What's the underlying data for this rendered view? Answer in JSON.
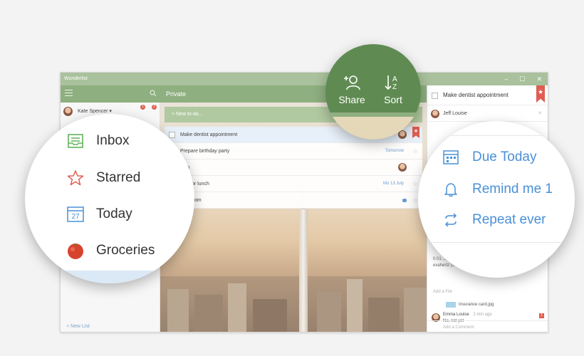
{
  "window": {
    "title": "Wunderlist",
    "min": "–",
    "max": "☐",
    "close": "✕"
  },
  "toolbar": {
    "list_title": "Private"
  },
  "user": {
    "name": "Kate Spencer ▾",
    "badge_a": "1",
    "badge_b": "2"
  },
  "sidebar": {
    "new_list": "+ New List"
  },
  "zoom_left": {
    "items": [
      {
        "label": "Inbox",
        "icon": "inbox-icon"
      },
      {
        "label": "Starred",
        "icon": "star-icon"
      },
      {
        "label": "Today",
        "icon": "calendar-icon",
        "day": "27"
      },
      {
        "label": "Groceries",
        "icon": "tomato-icon"
      }
    ]
  },
  "zoom_top": {
    "share": "Share",
    "sort": "Sort"
  },
  "new_todo": "+ New to-do...",
  "tasks": [
    {
      "title": "Make dentist appointment",
      "flag": "★"
    },
    {
      "title": "Prepare birthday party",
      "date": "Tomorrow",
      "star": "☆"
    },
    {
      "title": "Tom"
    },
    {
      "title": "Erik for lunch",
      "date": "Mo 13 July",
      "star": "☆"
    },
    {
      "title": "bathroom",
      "star": "☆"
    }
  ],
  "detail": {
    "title": "Make dentist appointment",
    "flag": "★",
    "assignee": "Jeff Louise",
    "remove": "✕",
    "note": "0.01 ... frequencies in the range 30 petahertz to 30 exahertz (3×1016 Hz to 3×1019 Hz)",
    "add_file": "Add a File",
    "file_name": "Insurance card.jpg",
    "comment_author": "Emma Louise",
    "comment_time": "2 min ago",
    "comment_text": "No, not yet",
    "comment_count": "1",
    "add_comment": "Add a Comment"
  },
  "zoom_right": {
    "items": [
      {
        "label": "Due Today",
        "icon": "due-date-icon"
      },
      {
        "label": "Remind me 1",
        "icon": "bell-icon"
      },
      {
        "label": "Repeat ever",
        "icon": "repeat-icon"
      }
    ]
  },
  "colors": {
    "accent_green": "#8eaf80",
    "flag_red": "#e05d52",
    "link_blue": "#4a90d9"
  }
}
